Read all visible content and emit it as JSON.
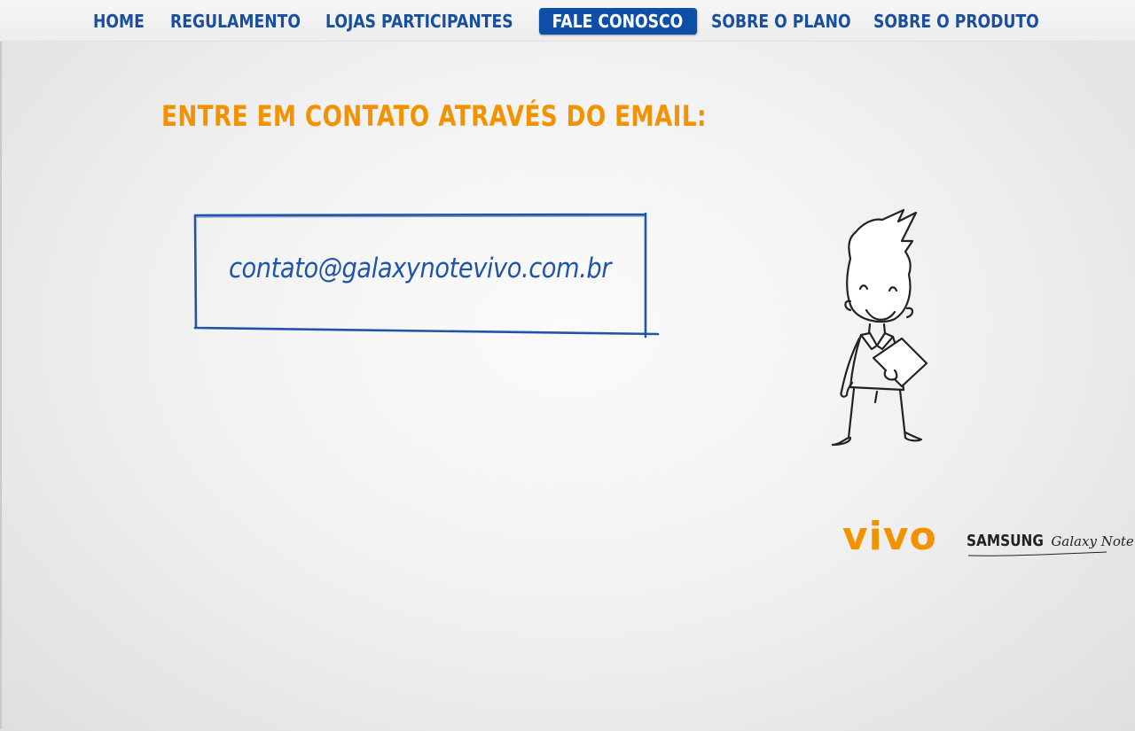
{
  "nav": {
    "items": [
      {
        "label": "HOME",
        "active": false
      },
      {
        "label": "REGULAMENTO",
        "active": false
      },
      {
        "label": "LOJAS PARTICIPANTES",
        "active": false
      },
      {
        "label": "FALE CONOSCO",
        "active": true
      },
      {
        "label": "SOBRE O PLANO",
        "active": false
      },
      {
        "label": "SOBRE O PRODUTO",
        "active": false
      }
    ]
  },
  "contact": {
    "heading": "ENTRE EM CONTATO ATRAVÉS DO EMAIL:",
    "email": "contato@galaxynotevivo.com.br"
  },
  "logos": {
    "vivo": "vivo",
    "samsung": "SAMSUNG",
    "galaxy_note": "Galaxy Note"
  },
  "colors": {
    "nav_text": "#1a4fa0",
    "nav_active_bg": "#0d4fa8",
    "heading_orange": "#f39200",
    "email_blue": "#1f55a8"
  },
  "icons": {
    "character": "cartoon-character-holding-tablet"
  }
}
